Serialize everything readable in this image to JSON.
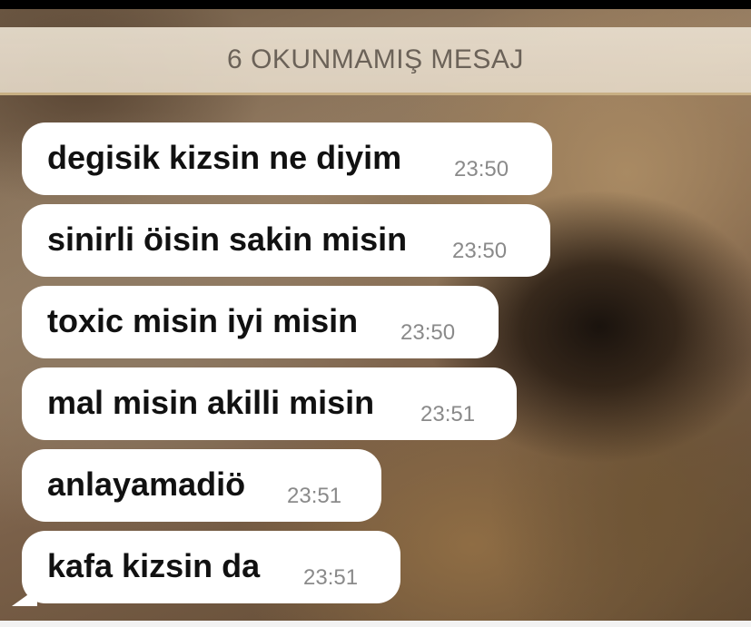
{
  "unread_banner": {
    "label": "6 OKUNMAMIŞ MESAJ"
  },
  "messages": [
    {
      "text": "degisik kizsin ne diyim",
      "time": "23:50"
    },
    {
      "text": "sinirli öisin sakin misin",
      "time": "23:50"
    },
    {
      "text": "toxic misin iyi misin",
      "time": "23:50"
    },
    {
      "text": "mal misin akilli misin",
      "time": "23:51"
    },
    {
      "text": "anlayamadiö",
      "time": "23:51"
    },
    {
      "text": "kafa kizsin da",
      "time": "23:51"
    }
  ],
  "colors": {
    "bubble": "#ffffff",
    "message_text": "#111111",
    "time_text": "#8a8a8a",
    "banner_background": "#e6dccb",
    "banner_text": "#6b6258"
  }
}
